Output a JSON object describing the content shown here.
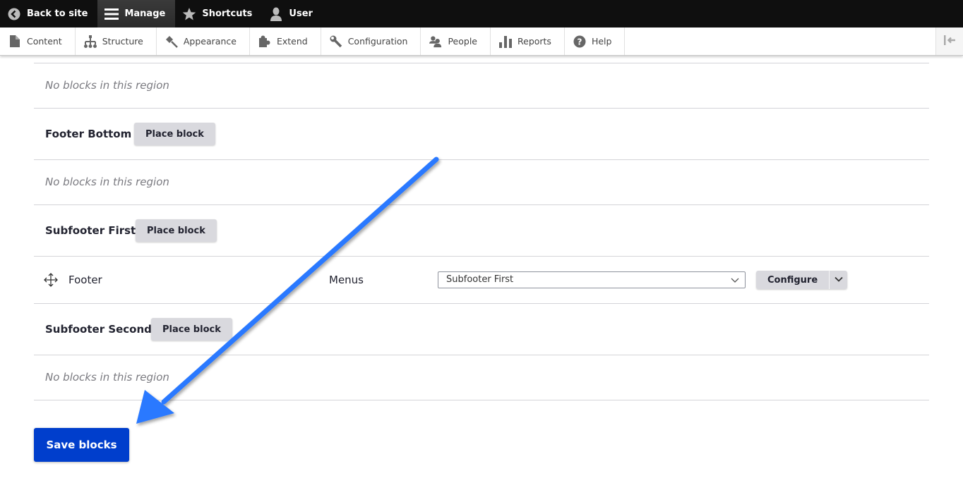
{
  "toolbar": {
    "items": [
      {
        "label": "Back to site",
        "icon": "back-arrow-circle-icon"
      },
      {
        "label": "Manage",
        "icon": "hamburger-menu-icon",
        "active": true
      },
      {
        "label": "Shortcuts",
        "icon": "star-icon"
      },
      {
        "label": "User",
        "icon": "user-icon"
      }
    ]
  },
  "tray": {
    "items": [
      {
        "label": "Content",
        "icon": "file-icon"
      },
      {
        "label": "Structure",
        "icon": "sitemap-icon"
      },
      {
        "label": "Appearance",
        "icon": "paintbrush-icon"
      },
      {
        "label": "Extend",
        "icon": "puzzle-icon"
      },
      {
        "label": "Configuration",
        "icon": "wrench-icon"
      },
      {
        "label": "People",
        "icon": "people-icon"
      },
      {
        "label": "Reports",
        "icon": "bar-chart-icon"
      },
      {
        "label": "Help",
        "icon": "help-icon"
      }
    ],
    "collapse_icon": "collapse-tray-icon"
  },
  "regions": {
    "top_empty_msg": "No blocks in this region",
    "footer_bottom": {
      "title": "Footer Bottom",
      "button": "Place block",
      "empty_msg": "No blocks in this region"
    },
    "subfooter_first": {
      "title": "Subfooter First",
      "button": "Place block",
      "block": {
        "name": "Footer",
        "category": "Menus",
        "region_select": "Subfooter First",
        "configure": "Configure"
      }
    },
    "subfooter_second": {
      "title": "Subfooter Second",
      "button": "Place block",
      "empty_msg": "No blocks in this region"
    }
  },
  "actions": {
    "save": "Save blocks"
  },
  "annotation": {
    "color": "#2979ff"
  }
}
